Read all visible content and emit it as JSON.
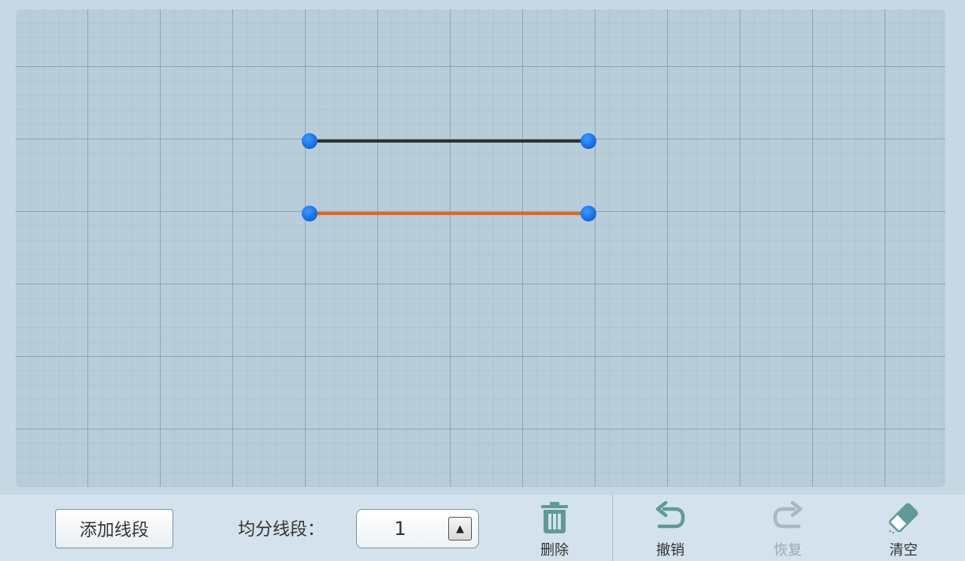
{
  "toolbar": {
    "add_segment_label": "添加线段",
    "divide_label": "均分线段：",
    "divide_value": "1",
    "delete_label": "删除",
    "undo_label": "撤销",
    "redo_label": "恢复",
    "clear_label": "清空"
  },
  "canvas": {
    "segments": [
      {
        "color": "#333333"
      },
      {
        "color": "#e8641c"
      }
    ],
    "endpoint_color": "#1a73e8"
  },
  "colors": {
    "icon_teal": "#5f9a98",
    "icon_disabled": "#a9b8c1"
  }
}
